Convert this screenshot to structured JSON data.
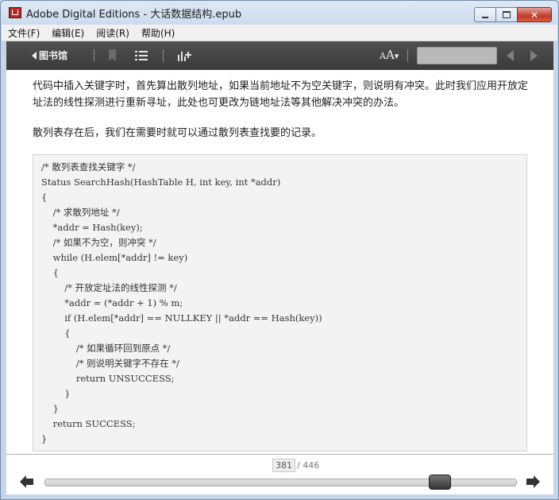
{
  "window": {
    "title": "Adobe Digital Editions - 大话数据结构.epub",
    "controls": {
      "minimize_icon": "minimize-icon",
      "maximize_icon": "maximize-icon",
      "close_icon": "close-icon",
      "close_label": "✕"
    }
  },
  "menu": {
    "items": [
      {
        "label": "文件(F)"
      },
      {
        "label": "编辑(E)"
      },
      {
        "label": "阅读(R)"
      },
      {
        "label": "帮助(H)"
      }
    ]
  },
  "toolbar": {
    "library_label": "图书馆",
    "font_size_label": "A",
    "font_size_big": "A",
    "search_value": "",
    "icons": [
      "bookmark-icon",
      "table-of-contents-icon",
      "add-chart-icon",
      "font-size-icon",
      "previous-page-icon",
      "next-page-icon"
    ]
  },
  "content": {
    "paragraph1": "代码中插入关键字时，首先算出散列地址，如果当前地址不为空关键字，则说明有冲突。此时我们应用开放定址法的线性探测进行重新寻址，此处也可更改为链地址法等其他解决冲突的办法。",
    "paragraph2": "散列表存在后，我们在需要时就可以通过散列表查找要的记录。",
    "code_lines": [
      "/* 散列表查找关键字 */",
      "Status SearchHash(HashTable H, int key, int *addr)",
      "{",
      "    /* 求散列地址 */",
      "    *addr = Hash(key);",
      "    /* 如果不为空，则冲突 */",
      "    while (H.elem[*addr] != key)",
      "    {",
      "        /* 开放定址法的线性探测 */",
      "        *addr = (*addr + 1) % m;",
      "        if (H.elem[*addr] == NULLKEY || *addr == Hash(key))",
      "        {",
      "            /* 如果循环回到原点 */",
      "            /* 则说明关键字不存在 */",
      "            return UNSUCCESS;",
      "        }",
      "    }",
      "    return SUCCESS;",
      "}"
    ]
  },
  "footer": {
    "page_current": "381",
    "page_total": "/ 446",
    "progress_fraction": 0.854,
    "icons": [
      "back-arrow-icon",
      "forward-arrow-icon"
    ]
  },
  "colors": {
    "toolbar_bg": "#3f3f3f",
    "close_button": "#c0392b",
    "codebox_bg": "#f3f3f3"
  }
}
